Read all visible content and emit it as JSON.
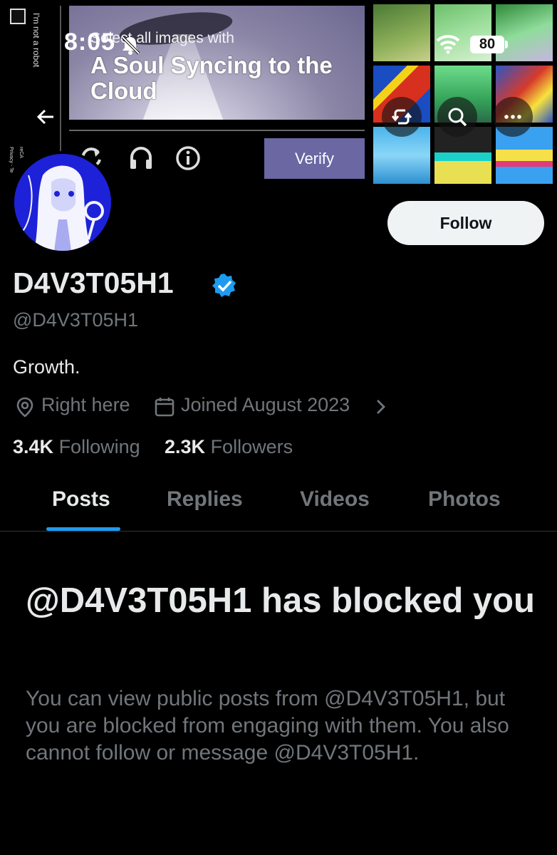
{
  "status_bar": {
    "time": "8:05",
    "battery": "80"
  },
  "captcha": {
    "checkbox_label": "I'm not a robot",
    "brand": "reCA",
    "privacy": "Privacy - Te",
    "instruction": "Select all images with",
    "challenge_title": "A Soul Syncing to the Cloud",
    "verify_label": "Verify"
  },
  "profile": {
    "follow_label": "Follow",
    "display_name": "D4V3T05H1",
    "handle": "@D4V3T05H1",
    "bio": "Growth.",
    "location": "Right here",
    "joined": "Joined August 2023",
    "following_count": "3.4K",
    "following_label": "Following",
    "followers_count": "2.3K",
    "followers_label": "Followers"
  },
  "tabs": [
    {
      "label": "Posts",
      "active": true
    },
    {
      "label": "Replies",
      "active": false
    },
    {
      "label": "Videos",
      "active": false
    },
    {
      "label": "Photos",
      "active": false
    }
  ],
  "blocked": {
    "title": "@D4V3T05H1 has blocked you",
    "description": "You can view public posts from @D4V3T05H1, but you are blocked from engaging with them. You also cannot follow or message @D4V3T05H1."
  },
  "colors": {
    "accent": "#1d9bf0",
    "background": "#000000",
    "muted_text": "#71767b",
    "primary_text": "#e7e9ea",
    "verify_button": "#6a67a3"
  },
  "icons": [
    "back-arrow-icon",
    "bell-off-icon",
    "wifi-icon",
    "battery-icon",
    "retweet-icon",
    "search-icon",
    "more-icon",
    "reload-icon",
    "headphones-icon",
    "info-icon",
    "verified-badge-icon",
    "location-icon",
    "calendar-icon",
    "chevron-right-icon"
  ]
}
